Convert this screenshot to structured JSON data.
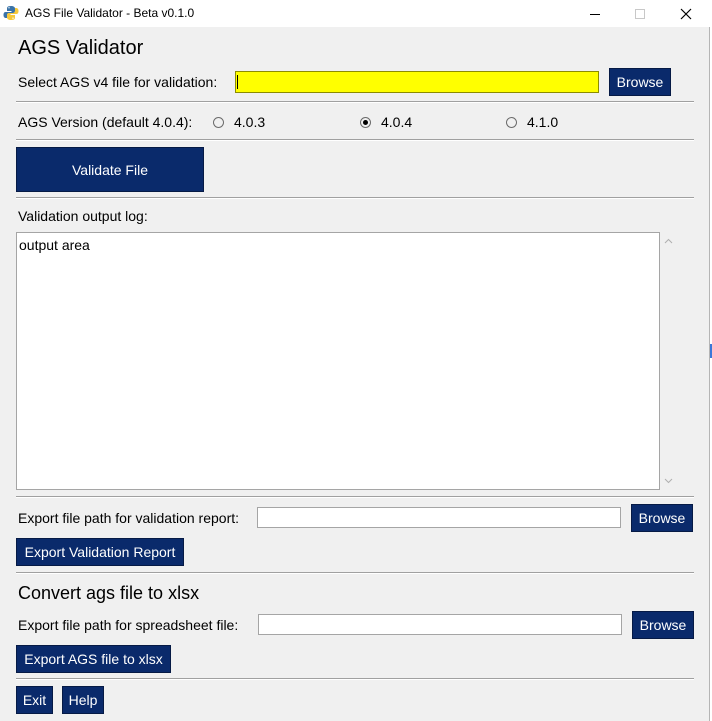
{
  "window": {
    "title": "AGS File Validator - Beta v0.1.0"
  },
  "validator": {
    "heading": "AGS Validator",
    "file_label": "Select AGS v4 file for validation:",
    "file_value": "",
    "browse_label": "Browse"
  },
  "version": {
    "label": "AGS Version (default 4.0.4):",
    "options": [
      "4.0.3",
      "4.0.4",
      "4.1.0"
    ],
    "selected": "4.0.4"
  },
  "validate_button": "Validate File",
  "log": {
    "label": "Validation output log:",
    "content": "output area"
  },
  "report": {
    "label": "Export file path for validation report:",
    "value": "",
    "browse_label": "Browse",
    "export_label": "Export Validation Report"
  },
  "convert": {
    "heading": "Convert ags file to xlsx",
    "label": "Export file path for spreadsheet file:",
    "value": "",
    "browse_label": "Browse",
    "export_label": "Export AGS file to xlsx"
  },
  "footer": {
    "exit_label": "Exit",
    "help_label": "Help"
  },
  "colors": {
    "button_bg": "#0a2a6b",
    "highlight_entry": "#ffff00"
  }
}
